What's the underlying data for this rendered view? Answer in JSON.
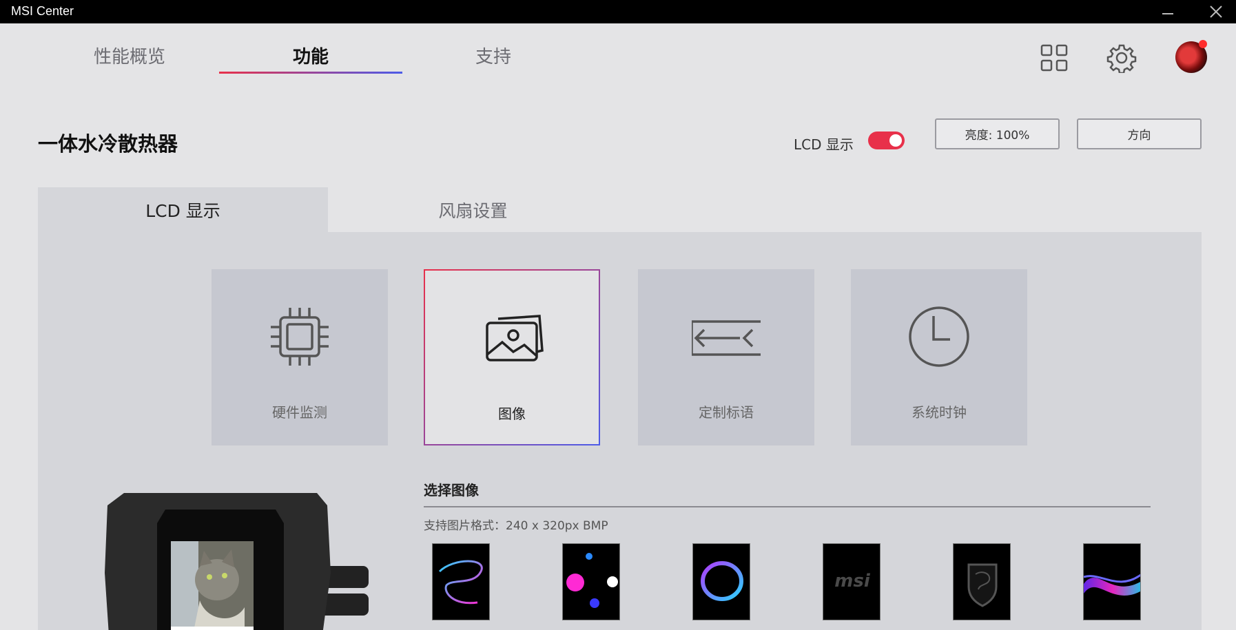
{
  "app": {
    "title": "MSI Center"
  },
  "nav": {
    "tabs": [
      {
        "label": "性能概览"
      },
      {
        "label": "功能"
      },
      {
        "label": "支持"
      }
    ],
    "active_tab": "功能",
    "accent_gradient": [
      "#e8304a",
      "#4c5be8"
    ]
  },
  "header": {
    "title": "一体水冷散热器",
    "lcd_toggle_label": "LCD 显示",
    "lcd_toggle_on": true,
    "brightness_button": "亮度: 100%",
    "direction_button": "方向"
  },
  "subtabs": [
    {
      "label": "LCD 显示",
      "active": true
    },
    {
      "label": "风扇设置",
      "active": false
    }
  ],
  "modes": [
    {
      "label": "硬件监测",
      "icon": "chip-icon",
      "selected": false
    },
    {
      "label": "图像",
      "icon": "images-icon",
      "selected": true
    },
    {
      "label": "定制标语",
      "icon": "banner-icon",
      "selected": false
    },
    {
      "label": "系统时钟",
      "icon": "clock-icon",
      "selected": false
    }
  ],
  "image_section": {
    "title": "选择图像",
    "hint": "支持图片格式：240 x 320px BMP",
    "thumbnails": [
      "swirl-thumbnail",
      "dots-thumbnail",
      "ring-thumbnail",
      "msi-logo-thumbnail",
      "msi-dragon-thumbnail",
      "wave-thumbnail"
    ]
  },
  "colors": {
    "toggle_on": "#e8304a",
    "background": "#e4e4e6",
    "panel": "#d5d6da"
  }
}
